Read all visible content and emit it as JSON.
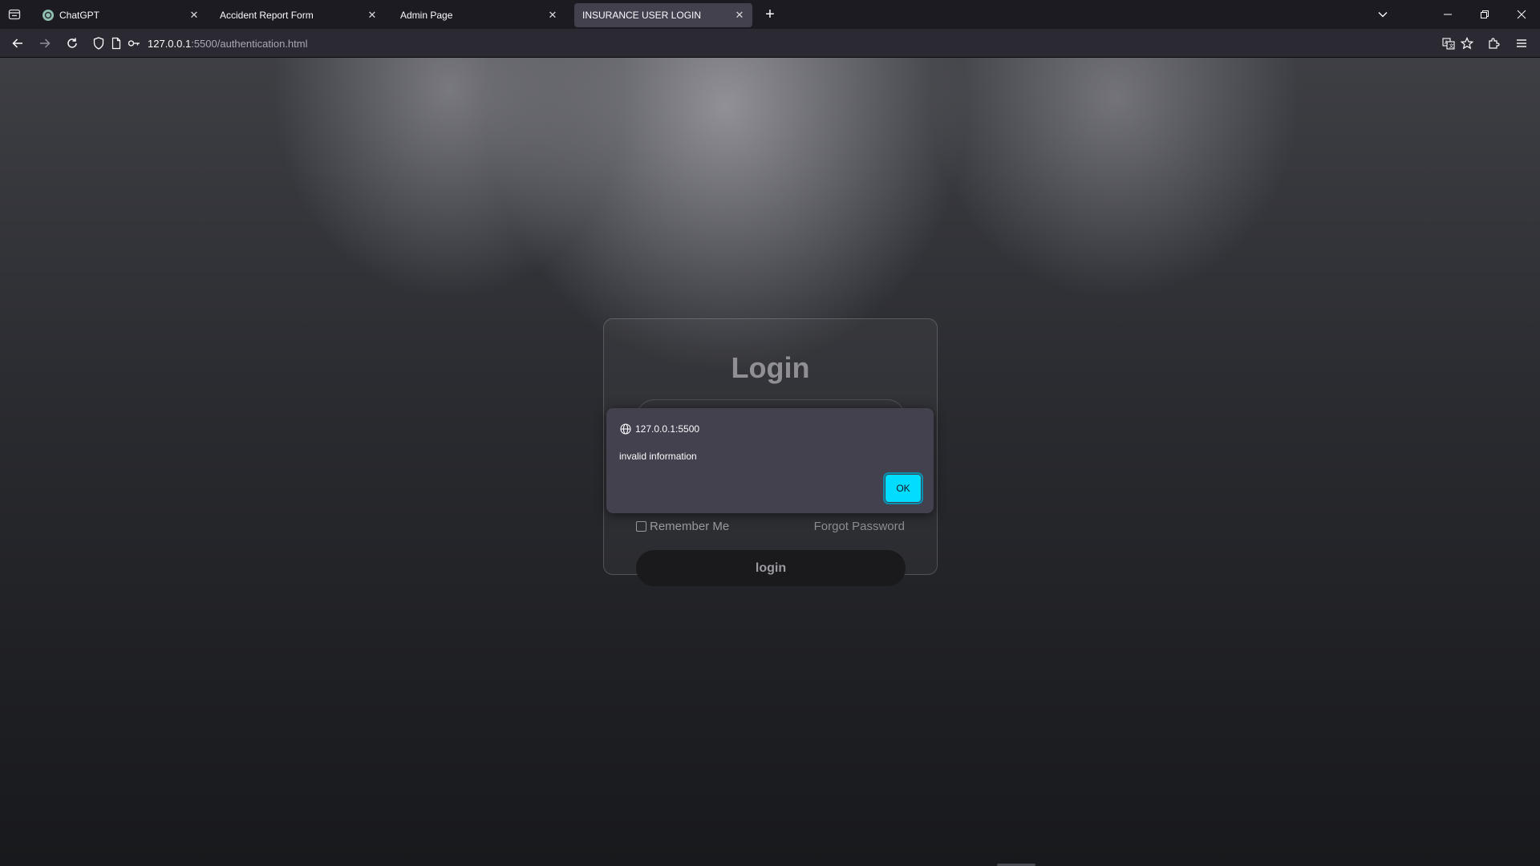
{
  "browser": {
    "tabs": [
      {
        "title": "ChatGPT",
        "active": false
      },
      {
        "title": "Accident Report Form",
        "active": false
      },
      {
        "title": "Admin Page",
        "active": false
      },
      {
        "title": "INSURANCE USER LOGIN",
        "active": true
      }
    ],
    "url": {
      "host": "127.0.0.1",
      "path": ":5500/authentication.html"
    }
  },
  "login": {
    "title": "Login",
    "remember_label": "Remember Me",
    "forgot_label": "Forgot Password",
    "button_label": "login",
    "remember_checked": false
  },
  "alert": {
    "origin": "127.0.0.1:5500",
    "message": "invalid information",
    "ok_label": "OK"
  },
  "colors": {
    "alert_ok": "#00ddff",
    "chrome_bg": "#1c1b22",
    "navbar_bg": "#2b2a33",
    "dialog_bg": "#42414d"
  }
}
